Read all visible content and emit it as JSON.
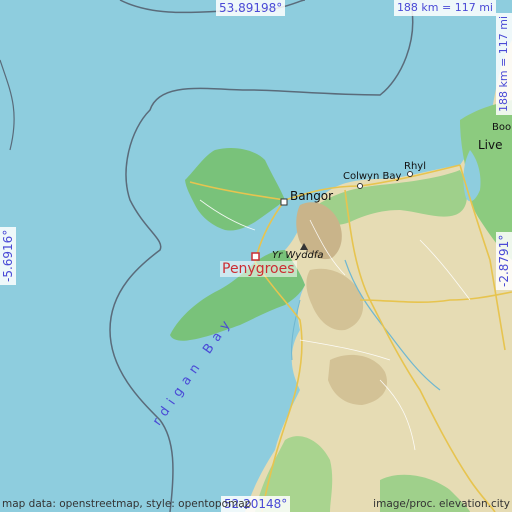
{
  "map": {
    "place_marker": "Penygroes",
    "towns": {
      "bangor": "Bangor",
      "colwyn_bay": "Colwyn Bay",
      "rhyl": "Rhyl",
      "liverpool": "Live",
      "yr_wyddfa": "Yr Wyddfa",
      "bootle": "Boo"
    },
    "bay": "rdigan Bay",
    "latitude_top": "53.89198°",
    "latitude_bottom": "52.20148°",
    "longitude_left": "-5.6916°",
    "longitude_right": "-2.8791°",
    "scale_horizontal": "188 km = 117 mi",
    "scale_vertical": "188 km = 117 mi",
    "credit_left": "map data: openstreetmap, style: opentopomap",
    "credit_right": "image/proc. elevation.city",
    "colors": {
      "sea": "#8ecdde",
      "land_green": "#79c27a",
      "land_tan": "#e6dcb4",
      "marker": "#cc2d33",
      "coord_text": "#4a4ad6"
    }
  }
}
